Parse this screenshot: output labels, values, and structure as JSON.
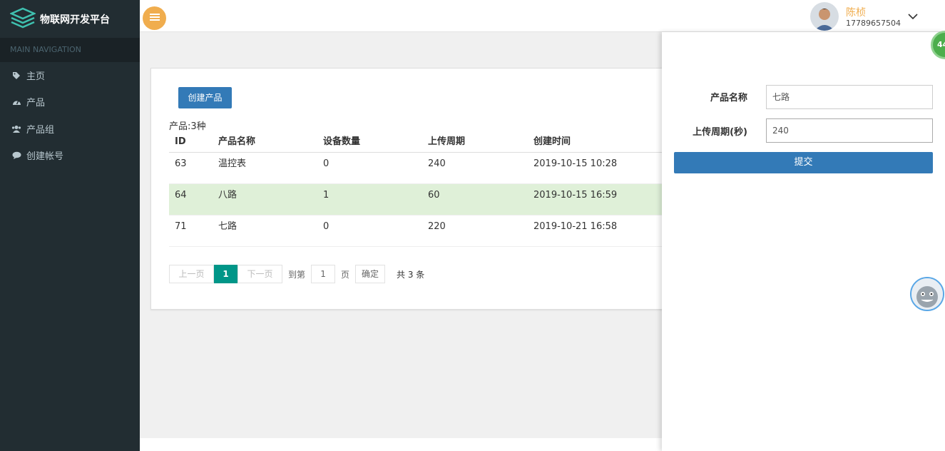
{
  "app": {
    "title": "物联网开发平台"
  },
  "sidebar": {
    "header": "MAIN NAVIGATION",
    "items": [
      {
        "label": "主页",
        "icon": "tag-icon"
      },
      {
        "label": "产品",
        "icon": "dashboard-icon"
      },
      {
        "label": "产品组",
        "icon": "users-icon"
      },
      {
        "label": "创建帐号",
        "icon": "comment-icon"
      }
    ]
  },
  "user": {
    "name": "陈桢",
    "phone": "17789657504"
  },
  "products": {
    "create_label": "创建产品",
    "count_label": "产品:3种",
    "columns": [
      "ID",
      "产品名称",
      "设备数量",
      "上传周期",
      "创建时间"
    ],
    "rows": [
      [
        "63",
        "温控表",
        "0",
        "240",
        "2019-10-15 10:28"
      ],
      [
        "64",
        "八路",
        "1",
        "60",
        "2019-10-15 16:59"
      ],
      [
        "71",
        "七路",
        "0",
        "220",
        "2019-10-21 16:58"
      ]
    ]
  },
  "pager": {
    "prev": "上一页",
    "current": "1",
    "next": "下一页",
    "goto_prefix": "到第",
    "goto_value": "1",
    "goto_suffix": "页",
    "confirm": "确定",
    "total": "共 3 条"
  },
  "form": {
    "name_label": "产品名称",
    "name_value": "七路",
    "period_label": "上传周期(秒)",
    "period_value": "240",
    "submit_label": "提交"
  },
  "badge": "44",
  "colors": {
    "sidebar": "#222d32",
    "accent": "#337ab7",
    "highlight": "#dff0d8",
    "page_active": "#009688",
    "user": "#f0ad4e"
  }
}
